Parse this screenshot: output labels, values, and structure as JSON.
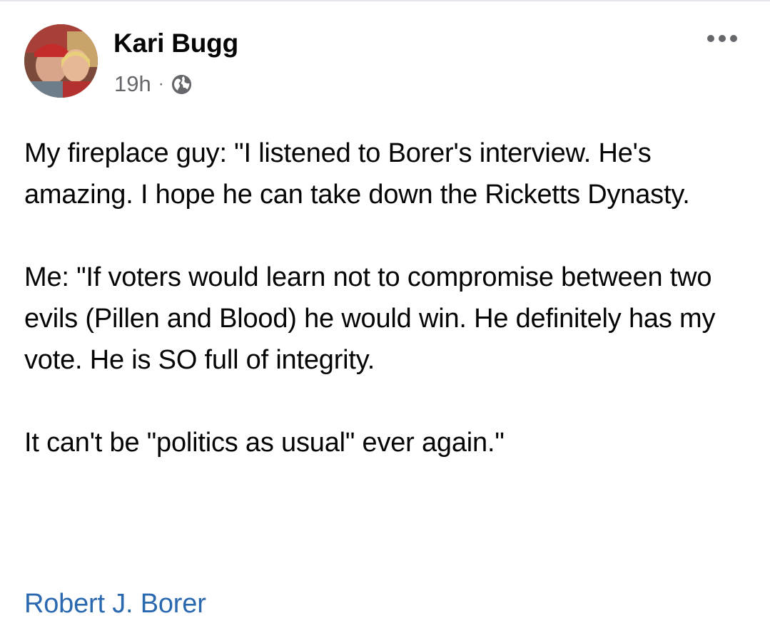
{
  "post": {
    "author_name": "Kari Bugg",
    "timestamp": "19h",
    "separator": "·",
    "audience_icon": "globe-icon",
    "more_icon": "more-options-icon",
    "avatar": "profile-photo",
    "paragraphs": [
      "My fireplace guy: \"I listened to Borer's interview. He's amazing. I hope he can take down the Ricketts Dynasty.",
      "Me: \"If voters would learn not to compromise between two evils (Pillen and Blood) he would win. He definitely has my vote. He is SO full of integrity.",
      "It can't be \"politics as usual\" ever again.\""
    ],
    "mention": "Robert J. Borer"
  },
  "colors": {
    "text_primary": "#050505",
    "text_secondary": "#65676b",
    "link": "#2a68b0"
  }
}
